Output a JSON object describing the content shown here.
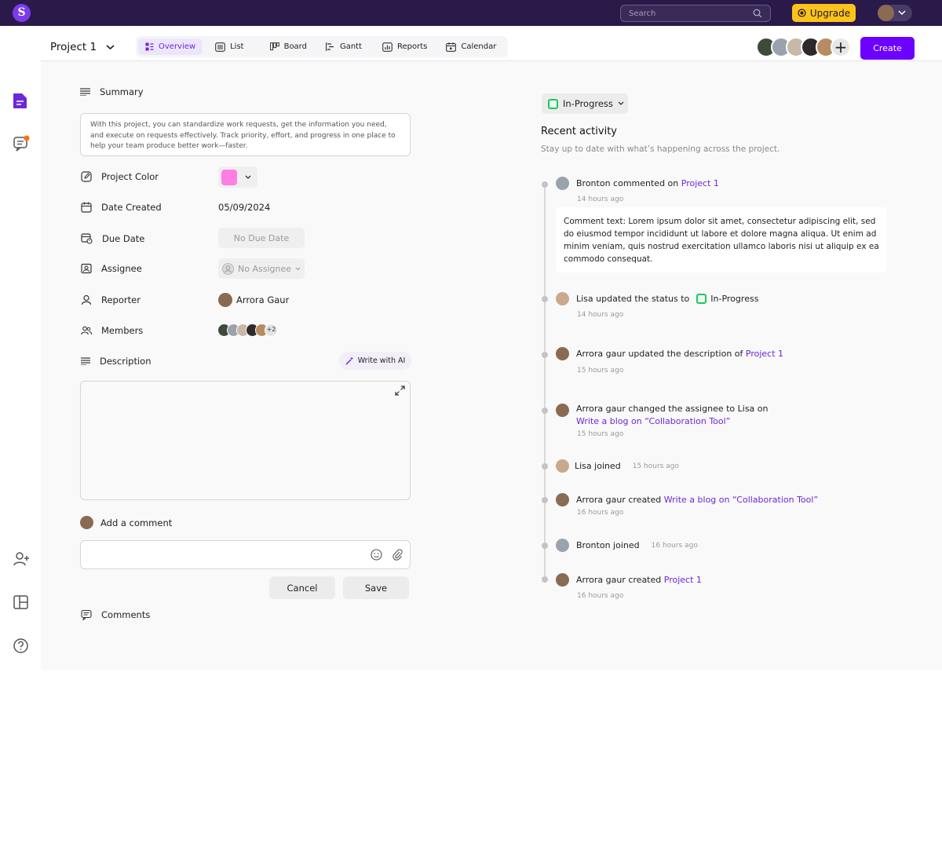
{
  "topbar": {
    "logo_letter": "S",
    "search": {
      "placeholder": "Search"
    },
    "upgrade_label": "Upgrade"
  },
  "project": {
    "title": "Project 1",
    "tabs": [
      {
        "label": "Overview",
        "icon": "overview-icon",
        "active": true
      },
      {
        "label": "List",
        "icon": "list-icon"
      },
      {
        "label": "Board",
        "icon": "board-icon"
      },
      {
        "label": "Gantt",
        "icon": "gantt-icon"
      },
      {
        "label": "Reports",
        "icon": "reports-icon"
      },
      {
        "label": "Calendar",
        "icon": "calendar-icon"
      }
    ],
    "create_label": "Create"
  },
  "details": {
    "summary_label": "Summary",
    "summary_text": "With this project, you can standardize work requests, get the information you need, and execute on requests effectively. Track priority, effort, and progress in one place to help your team produce better work—faster.",
    "project_color_label": "Project Color",
    "project_color_value": "#ff7ee5",
    "date_created_label": "Date Created",
    "date_created_value": "05/09/2024",
    "due_date_label": "Due Date",
    "due_date_value": "No Due Date",
    "assignee_label": "Assignee",
    "assignee_value": "No Assignee",
    "reporter_label": "Reporter",
    "reporter_value": "Arrora Gaur",
    "members_label": "Members",
    "members_extra": "+2",
    "description_label": "Description",
    "write_ai_label": "Write with AI",
    "add_comment_label": "Add a comment",
    "cancel_label": "Cancel",
    "save_label": "Save",
    "comments_label": "Comments"
  },
  "activity": {
    "status": "In-Progress",
    "title": "Recent activity",
    "subtitle": "Stay up to date with what’s happening across the project.",
    "items": [
      {
        "actor": "Bronton",
        "action": "commented on",
        "target": "Project 1",
        "time": "14 hours ago"
      },
      {
        "actor": "Lisa",
        "action": "updated the status to",
        "status": "In-Progress",
        "time": "14 hours ago"
      },
      {
        "actor": "Arrora gaur",
        "action": "updated the description of",
        "target": "Project 1",
        "time": "15 hours ago"
      },
      {
        "actor": "Arrora gaur",
        "action": "changed the assignee to Lisa on",
        "target": "Write a blog on “Collaboration Tool”",
        "time": "15 hours ago"
      },
      {
        "actor": "Lisa",
        "action": "joined",
        "time": "15 hours ago"
      },
      {
        "actor": "Arrora gaur",
        "action": "created",
        "target": "Write a blog on “Collaboration Tool”",
        "time": "16 hours ago"
      },
      {
        "actor": "Bronton",
        "action": "joined",
        "time": "16 hours ago"
      },
      {
        "actor": "Arrora gaur",
        "action": "created",
        "target": "Project 1",
        "time": "16 hours ago"
      }
    ],
    "comment_text": "Comment text: Lorem ipsum dolor sit amet, consectetur adipiscing elit, sed do eiusmod tempor incididunt ut labore et dolore magna aliqua. Ut enim ad minim veniam, quis nostrud exercitation ullamco laboris nisi ut aliquip ex ea commodo consequat."
  },
  "colors": {
    "brand": "#6d00ff",
    "topbar": "#2a1a4a",
    "upgrade": "#fcc419",
    "status_green": "#22c55e"
  }
}
